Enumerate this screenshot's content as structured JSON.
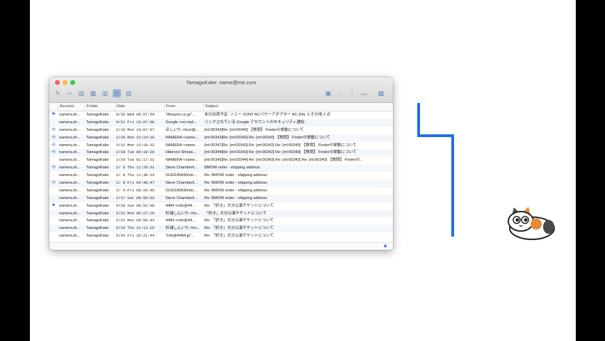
{
  "window": {
    "title": "TamagoKake: name@me.com",
    "lights": [
      "#fc605c",
      "#fdbc40",
      "#34c84a"
    ]
  },
  "toolbar": {
    "left_icons": [
      "compose-icon",
      "reply-icon",
      "document-icon",
      "save-icon",
      "view-columns-icon",
      "view-split-icon",
      "view-bottom-icon"
    ],
    "right_icons": [
      "folder-move-icon",
      "archive-icon",
      "trash-icon",
      "print-icon",
      "mailbox-icon"
    ]
  },
  "columns": [
    "Account",
    "Folder",
    "Date",
    "From",
    "Subject"
  ],
  "rows": [
    {
      "flag": "flag-icon",
      "account": "namera.dr...",
      "folder": "TamagoKake",
      "date": "9/26 Wed 08:57:54",
      "from": "\"Amazon.co.jp\"...",
      "subject": "本日出荷予定: ソニー SONY ACパワーアダプター AC-D4L とその他 2 点"
    },
    {
      "flag": "",
      "account": "namera.dr...",
      "folder": "TamagoKake",
      "date": "9/21 Fri 23:07:08",
      "from": "Google <no-repl...",
      "subject": "リンクされている Google アカウントのセキュリティ通知"
    },
    {
      "flag": "reply-icon",
      "account": "namera.dr...",
      "folder": "TamagoKake",
      "date": "2/19 Mon 23:07:57",
      "from": "ほしいち <hosi@...",
      "subject": "[ml:00342]Re: [ml:00340] 【質問】 Finderの挙動について"
    },
    {
      "flag": "reply-icon",
      "account": "namera.dr...",
      "folder": "TamagoKake",
      "date": "2/19 Mon 23:24:16",
      "from": "NAMERA <name...",
      "subject": "    [ml:00343]Re: [ml:00342] Re: [ml:00340] 【質問】 Finderの挙動について"
    },
    {
      "flag": "reply-icon",
      "account": "namera.dr...",
      "folder": "TamagoKake",
      "date": "3/12 Mon 13:19:32",
      "from": "NAMERA <name...",
      "subject": "    [ml:00347]Re: [ml:00343] Re: [ml:00342] Re: [ml:00340] 【質問】 Finderの挙動について"
    },
    {
      "flag": "reply-icon",
      "account": "namera.dr...",
      "folder": "TamagoKake",
      "date": "2/20 Tue 00:19:29",
      "from": "Hidenori Shirais...",
      "subject": "    [ml:00344]Re: [ml:00343] Re: [ml:00342] Re: [ml:00340] 【質問】 Finderの挙動について"
    },
    {
      "flag": "",
      "account": "namera.dr...",
      "folder": "TamagoKake",
      "date": "2/20 Tue 01:17:31",
      "from": "NAMERA <name...",
      "subject": "    [ml:00345]Re: [ml:00344] Re: [ml:00343] Re: [ml:00342] Re: [ml:00340] 【質問】 Finderの..."
    },
    {
      "flag": "reply-icon",
      "account": "namera.dr...",
      "folder": "TamagoKake",
      "date": "2/ 8 Thu 11:29:31",
      "from": "Steve Chamberli...",
      "subject": "BMOW order - shipping address"
    },
    {
      "flag": "",
      "account": "namera.dr...",
      "folder": "TamagoKake",
      "date": "2/ 8 Thu 11:30:23",
      "from": "SUGIURAShinic...",
      "subject": "    Re: BMOW order - shipping address"
    },
    {
      "flag": "reply-icon",
      "account": "namera.dr...",
      "folder": "TamagoKake",
      "date": "2/ 9 Fri 04:48:47",
      "from": "Steve Chamberli...",
      "subject": "    Re: BMOW order - shipping address"
    },
    {
      "flag": "",
      "account": "namera.dr...",
      "folder": "TamagoKake",
      "date": "2/ 9 Fri 09:26:46",
      "from": "SUGIURAShinic...",
      "subject": "    Re: BMOW order - shipping address"
    },
    {
      "flag": "",
      "account": "namera.dr...",
      "folder": "TamagoKake",
      "date": "2/17 Sat 08:56:03",
      "from": "Steve Chamberli...",
      "subject": "    Re: BMOW order - shipping address"
    },
    {
      "flag": "flag-icon",
      "account": "namera.dr...",
      "folder": "TamagoKake",
      "date": "5/28 Sun 08:52:00",
      "from": "4484 <info@44...",
      "subject": "Re: 「好き」大分公演チケットについて"
    },
    {
      "flag": "",
      "account": "namera.dr...",
      "folder": "TamagoKake",
      "date": "5/22 Mon 00:27:29",
      "from": "杉浦しんいち <ho...",
      "subject": "「好き」大分公演チケットについて"
    },
    {
      "flag": "",
      "account": "namera.dr...",
      "folder": "TamagoKake",
      "date": "5/22 Mon 09:50:43",
      "from": "4484 <info@44...",
      "subject": "    Re: 「好き」大分公演チケットについて"
    },
    {
      "flag": "",
      "account": "namera.dr...",
      "folder": "TamagoKake",
      "date": "5/25 Thu 21:13:25",
      "from": "杉浦しんいち <ho...",
      "subject": "    Re: 「好き」大分公演チケットについて"
    },
    {
      "flag": "",
      "account": "namera.dr...",
      "folder": "TamagoKake",
      "date": "5/26 Fri 20:21:44",
      "from": "\"info@4484.jp\"...",
      "subject": "    Re: 「好き」大分公演チケットについて"
    }
  ],
  "icon_glyphs": {
    "flag-icon": "⚑",
    "reply-icon": "⟲"
  },
  "status": {
    "settings_icon": "gear-icon"
  },
  "decoration": {
    "line_color": "#1f6fe0",
    "mascot": "calico-cat-icon"
  }
}
